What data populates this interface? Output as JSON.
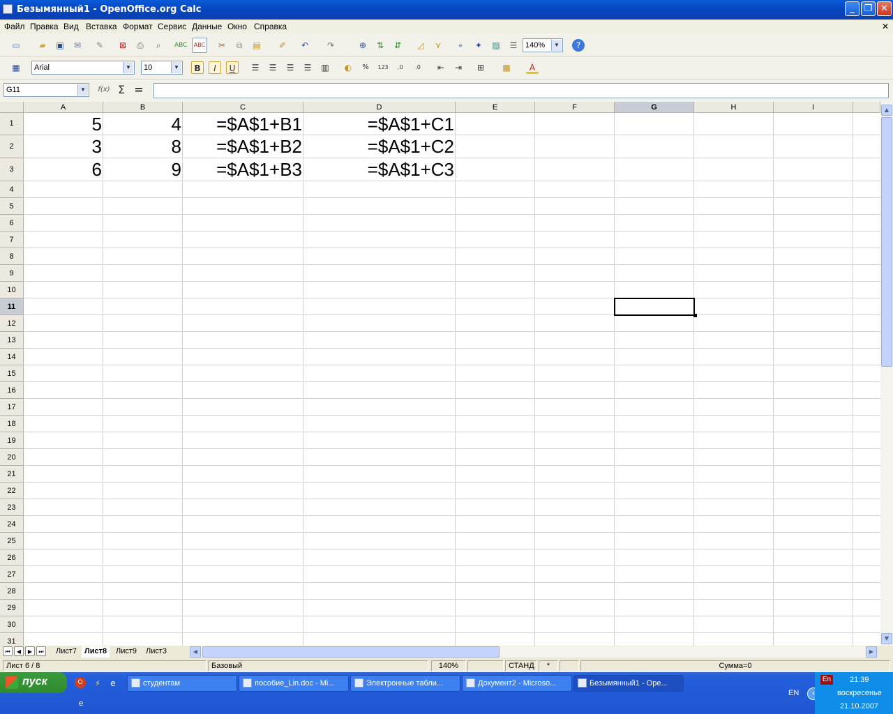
{
  "window": {
    "title": "Безымянный1 - OpenOffice.org Calc"
  },
  "menu": [
    "Файл",
    "Правка",
    "Вид",
    "Вставка",
    "Формат",
    "Сервис",
    "Данные",
    "Окно",
    "Справка"
  ],
  "toolbar": {
    "zoom": "140%",
    "font_name": "Arial",
    "font_size": "10",
    "bold": "B",
    "italic": "I",
    "underline": "U"
  },
  "formula": {
    "name_box": "G11",
    "content": ""
  },
  "columns": [
    "A",
    "B",
    "C",
    "D",
    "E",
    "F",
    "G",
    "H",
    "I"
  ],
  "selected_cell": "G11",
  "rows": [
    "1",
    "2",
    "3",
    "4",
    "5",
    "6",
    "7",
    "8",
    "9",
    "10",
    "11",
    "12",
    "13",
    "14",
    "15",
    "16",
    "17",
    "18",
    "19",
    "20",
    "21",
    "22",
    "23",
    "24",
    "25",
    "26",
    "27",
    "28",
    "29",
    "30",
    "31"
  ],
  "cells": {
    "A1": "5",
    "B1": "4",
    "C1": "=$A$1+B1",
    "D1": "=$A$1+C1",
    "A2": "3",
    "B2": "8",
    "C2": "=$A$1+B2",
    "D2": "=$A$1+C2",
    "A3": "6",
    "B3": "9",
    "C3": "=$A$1+B3",
    "D3": "=$A$1+C3"
  },
  "sheet_tabs": [
    "Лист7",
    "Лист8",
    "Лист9",
    "Лист3"
  ],
  "active_sheet": "Лист8",
  "status": {
    "sheet": "Лист 6 / 8",
    "style": "Базовый",
    "zoom": "140%",
    "mode": "СТАНД",
    "modified": "*",
    "sum": "Сумма=0"
  },
  "taskbar": {
    "start_label": "пуск",
    "tasks": [
      "студентам",
      "пособие_Lin.doc - Mi...",
      "Электронные табли...",
      "Документ2 - Microso...",
      "Безымянный1 - Ope..."
    ],
    "lang": "EN",
    "lang_badge": "En",
    "time": "21:39",
    "day": "воскресенье",
    "date": "21.10.2007"
  }
}
